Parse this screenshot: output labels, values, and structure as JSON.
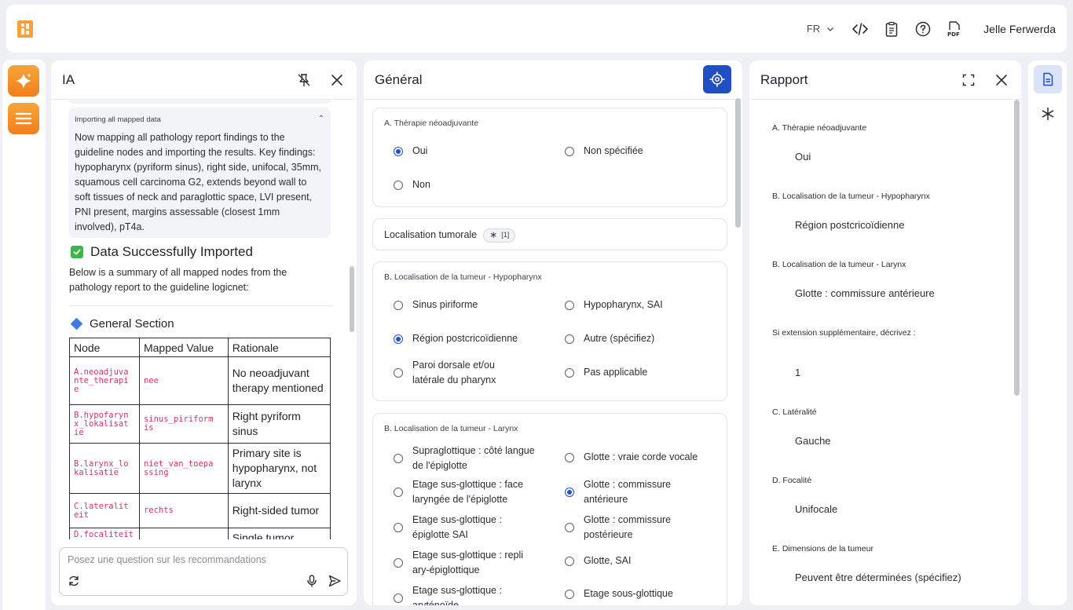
{
  "topbar": {
    "language": "FR",
    "username": "Jelle Ferwerda",
    "icons": [
      "code-icon",
      "clipboard-icon",
      "help-icon",
      "pdf-icon"
    ]
  },
  "ia": {
    "title": "IA",
    "thinking_title": "Importing all mapped data",
    "thinking_body": "Now mapping all pathology report findings to the guideline nodes and importing the results. Key findings: hypopharynx (pyriform sinus), right side, unifocal, 35mm, squamous cell carcinoma G2, extends beyond wall to soft tissues of neck and paraglottic space, LVI present, PNI present, margins assessable (closest 1mm involved), pT4a.",
    "success_title": "Data Successfully Imported",
    "summary": "Below is a summary of all mapped nodes from the pathology report to the guideline logicnet:",
    "section_title": "General Section",
    "table_headers": [
      "Node",
      "Mapped Value",
      "Rationale"
    ],
    "table_rows": [
      {
        "node": "A.neoadjuva nte_therapi e",
        "value": "nee",
        "rationale": "No neoadjuvant therapy mentioned"
      },
      {
        "node": "B.hypofaryn x_lokalisat ie",
        "value": "sinus_piriform is",
        "rationale": "Right pyriform sinus"
      },
      {
        "node": "B.larynx_lo kalisatie",
        "value": "niet_van_toepa ssing",
        "rationale": "Primary site is hypopharynx, not larynx"
      },
      {
        "node": "C.lateralit eit",
        "value": "rechts",
        "rationale": "Right-sided tumor"
      },
      {
        "node": "D.focaliteit",
        "value": "",
        "rationale": "Single tumor"
      }
    ],
    "chat_placeholder": "Posez une question sur les recommandations"
  },
  "general": {
    "title": "Général",
    "card_a": {
      "title": "A. Thérapie néoadjuvante",
      "options": [
        {
          "label": "Oui",
          "checked": true
        },
        {
          "label": "Non spécifiée",
          "checked": false
        },
        {
          "label": "Non",
          "checked": false
        }
      ]
    },
    "localisation": {
      "label": "Localisation tumorale",
      "tag": "[1]"
    },
    "card_hypo": {
      "title": "B. Localisation de la tumeur - Hypopharynx",
      "options": [
        {
          "label": "Sinus piriforme",
          "checked": false
        },
        {
          "label": "Hypopharynx, SAI",
          "checked": false
        },
        {
          "label": "Région postcricoïdienne",
          "checked": true
        },
        {
          "label": "Autre (spécifiez)",
          "checked": false
        },
        {
          "label": "Paroi dorsale et/ou latérale du pharynx",
          "checked": false
        },
        {
          "label": "Pas applicable",
          "checked": false
        }
      ]
    },
    "card_larynx": {
      "title": "B. Localisation de la tumeur - Larynx",
      "options": [
        {
          "label": "Supraglottique : côté langue de l'épiglotte",
          "checked": false
        },
        {
          "label": "Glotte : vraie corde vocale",
          "checked": false
        },
        {
          "label": "Etage sus-glottique : face laryngée de l'épiglotte",
          "checked": false
        },
        {
          "label": "Glotte : commissure antérieure",
          "checked": true
        },
        {
          "label": "Etage sus-glottique : épiglotte SAI",
          "checked": false
        },
        {
          "label": "Glotte : commissure postérieure",
          "checked": false
        },
        {
          "label": "Etage sus-glottique : repli ary-épiglottique",
          "checked": false
        },
        {
          "label": "Glotte, SAI",
          "checked": false
        },
        {
          "label": "Etage sus-glottique : aryténoïde",
          "checked": false
        },
        {
          "label": "Etage sous-glottique",
          "checked": false
        }
      ]
    }
  },
  "rapport": {
    "title": "Rapport",
    "items": [
      {
        "label": "A. Thérapie néoadjuvante",
        "value": "Oui"
      },
      {
        "label": "B. Localisation de la tumeur - Hypopharynx",
        "value": "Région postcricoïdienne"
      },
      {
        "label": "B. Localisation de la tumeur - Larynx",
        "value": "Glotte : commissure antérieure"
      },
      {
        "label": "Si extension supplémentaire, décrivez :",
        "value": "1"
      },
      {
        "label": "C. Latéralité",
        "value": "Gauche"
      },
      {
        "label": "D. Focalité",
        "value": "Unifocale"
      },
      {
        "label": "E. Dimensions de la tumeur",
        "value": "Peuvent être déterminées (spécifiez)"
      }
    ]
  },
  "colors": {
    "accent": "#1f4fc2",
    "orange": "#f27e1e",
    "success": "#3cb54a",
    "code": "#d6336c"
  }
}
